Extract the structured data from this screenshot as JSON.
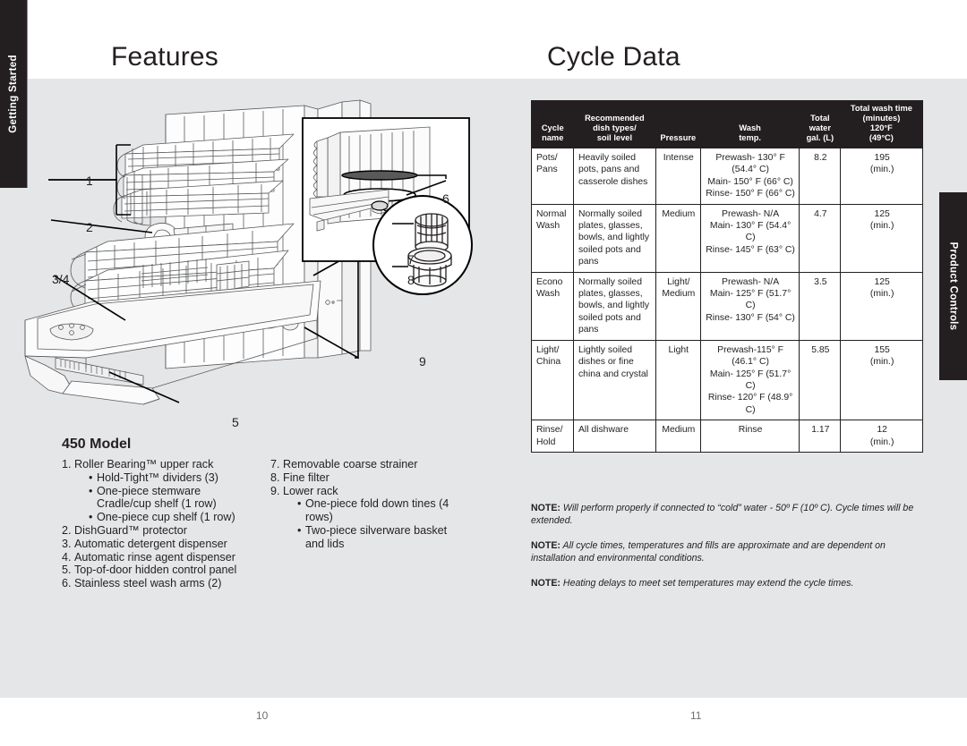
{
  "document": {
    "tabs": {
      "left": "Getting Started",
      "right": "Product Controls"
    },
    "left_page": {
      "heading": "Features",
      "folio": "10",
      "model_heading": "450 Model",
      "callouts": [
        "1",
        "2",
        "3/4",
        "5",
        "6",
        "7",
        "8",
        "9"
      ],
      "list_column_1": [
        {
          "num": "1.",
          "text": "Roller Bearing™ upper rack",
          "bullets": [
            "Hold-Tight™ dividers (3)",
            "One-piece stemware Cradle/cup shelf (1 row)",
            "One-piece cup shelf (1 row)"
          ]
        },
        {
          "num": "2.",
          "text": "DishGuard™ protector",
          "bullets": []
        },
        {
          "num": "3.",
          "text": "Automatic detergent dispenser",
          "bullets": []
        },
        {
          "num": "4.",
          "text": "Automatic rinse agent dispenser",
          "bullets": []
        },
        {
          "num": "5.",
          "text": "Top-of-door hidden control panel",
          "bullets": []
        },
        {
          "num": "6.",
          "text": "Stainless steel wash arms (2)",
          "bullets": []
        }
      ],
      "list_column_2": [
        {
          "num": "7.",
          "text": "Removable coarse strainer",
          "bullets": []
        },
        {
          "num": "8.",
          "text": "Fine filter",
          "bullets": []
        },
        {
          "num": "9.",
          "text": "Lower rack",
          "bullets": [
            "One-piece fold down tines (4 rows)",
            "Two-piece silverware basket and lids"
          ]
        }
      ]
    },
    "right_page": {
      "heading": "Cycle Data",
      "folio": "11",
      "table": {
        "headers": [
          "Cycle\nname",
          "Recommended\ndish types/\nsoil level",
          "Pressure",
          "Wash\ntemp.",
          "Total\nwater\ngal. (L)",
          "Total wash time\n(minutes)\n120°F\n(49°C)"
        ],
        "rows": [
          {
            "name": "Pots/\nPans",
            "dish": "Heavily soiled pots, pans and casserole dishes",
            "pressure": "Intense",
            "temp": "Prewash- 130° F\n(54.4° C)\nMain- 150° F (66° C)\nRinse- 150° F (66° C)",
            "water": "8.2",
            "time": "195\n(min.)"
          },
          {
            "name": "Normal\nWash",
            "dish": "Normally soiled plates, glasses, bowls, and lightly soiled pots and pans",
            "pressure": "Medium",
            "temp": "Prewash- N/A\nMain- 130° F (54.4° C)\nRinse- 145° F (63° C)",
            "water": "4.7",
            "time": "125\n(min.)"
          },
          {
            "name": "Econo\nWash",
            "dish": "Normally soiled plates, glasses, bowls, and lightly soiled pots and pans",
            "pressure": "Light/\nMedium",
            "temp": "Prewash- N/A\nMain- 125° F (51.7° C)\nRinse- 130° F (54° C)",
            "water": "3.5",
            "time": "125\n(min.)"
          },
          {
            "name": "Light/\nChina",
            "dish": "Lightly soiled dishes or fine china and crystal",
            "pressure": "Light",
            "temp": "Prewash-115° F\n(46.1° C)\nMain- 125° F (51.7° C)\nRinse- 120° F (48.9° C)",
            "water": "5.85",
            "time": "155\n(min.)"
          },
          {
            "name": "Rinse/\nHold",
            "dish": "All dishware",
            "pressure": "Medium",
            "temp": "Rinse",
            "water": "1.17",
            "time": "12\n(min.)"
          }
        ]
      },
      "notes": [
        {
          "label": "NOTE:",
          "text": " Will perform properly if connected to “cold” water - 50º F (10º C). Cycle times will be extended."
        },
        {
          "label": "NOTE:",
          "text": " All cycle times, temperatures and fills are approximate and are dependent on installation and environmental conditions."
        },
        {
          "label": "NOTE:",
          "text": " Heating delays to meet set temperatures may extend the cycle times."
        }
      ]
    },
    "colors": {
      "page_background": "#ffffff",
      "band_grey": "#e5e6e8",
      "ink": "#231f20",
      "tab_dark": "#231f20",
      "tab_accent": "#9b7fa0"
    }
  }
}
